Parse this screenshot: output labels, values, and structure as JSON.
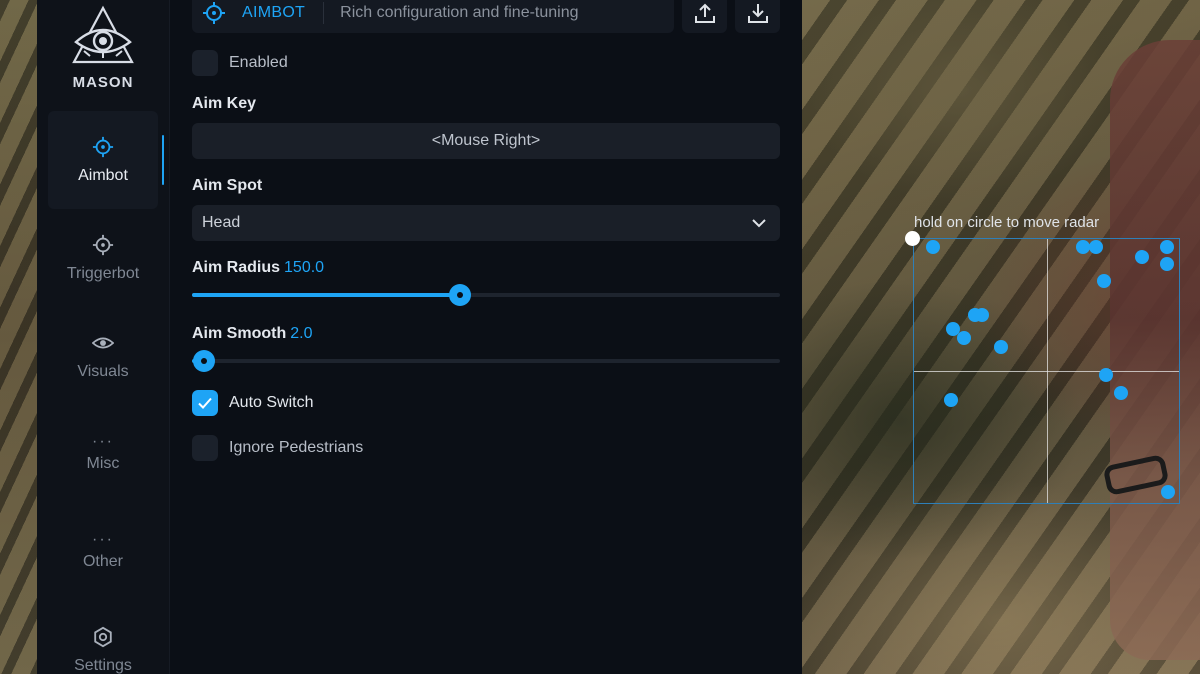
{
  "app": {
    "logo_text": "MASON",
    "accent_color": "#1ea4f5"
  },
  "sidebar": {
    "items": [
      {
        "label": "Aimbot",
        "icon": "crosshair-icon",
        "active": true
      },
      {
        "label": "Triggerbot",
        "icon": "crosshair-icon",
        "active": false
      },
      {
        "label": "Visuals",
        "icon": "eye-icon",
        "active": false
      },
      {
        "label": "Misc",
        "icon": "dots-icon",
        "active": false
      },
      {
        "label": "Other",
        "icon": "dots-icon",
        "active": false
      },
      {
        "label": "Settings",
        "icon": "gear-icon",
        "active": false
      }
    ]
  },
  "header": {
    "title": "AIMBOT",
    "description": "Rich configuration and fine-tuning",
    "export_icon": "upload-icon",
    "import_icon": "download-icon"
  },
  "aimbot": {
    "enabled": {
      "label": "Enabled",
      "checked": false
    },
    "aim_key": {
      "label": "Aim Key",
      "value": "<Mouse Right>"
    },
    "aim_spot": {
      "label": "Aim Spot",
      "value": "Head"
    },
    "aim_radius": {
      "label": "Aim Radius",
      "value": "150.0",
      "fraction": 0.456
    },
    "aim_smooth": {
      "label": "Aim Smooth",
      "value": "2.0",
      "fraction": 0.02
    },
    "auto_switch": {
      "label": "Auto Switch",
      "checked": true
    },
    "ignore_pedestrians": {
      "label": "Ignore Pedestrians",
      "checked": false
    }
  },
  "radar": {
    "hint": "hold on circle to move radar",
    "blip_color": "#1ea4f5"
  }
}
